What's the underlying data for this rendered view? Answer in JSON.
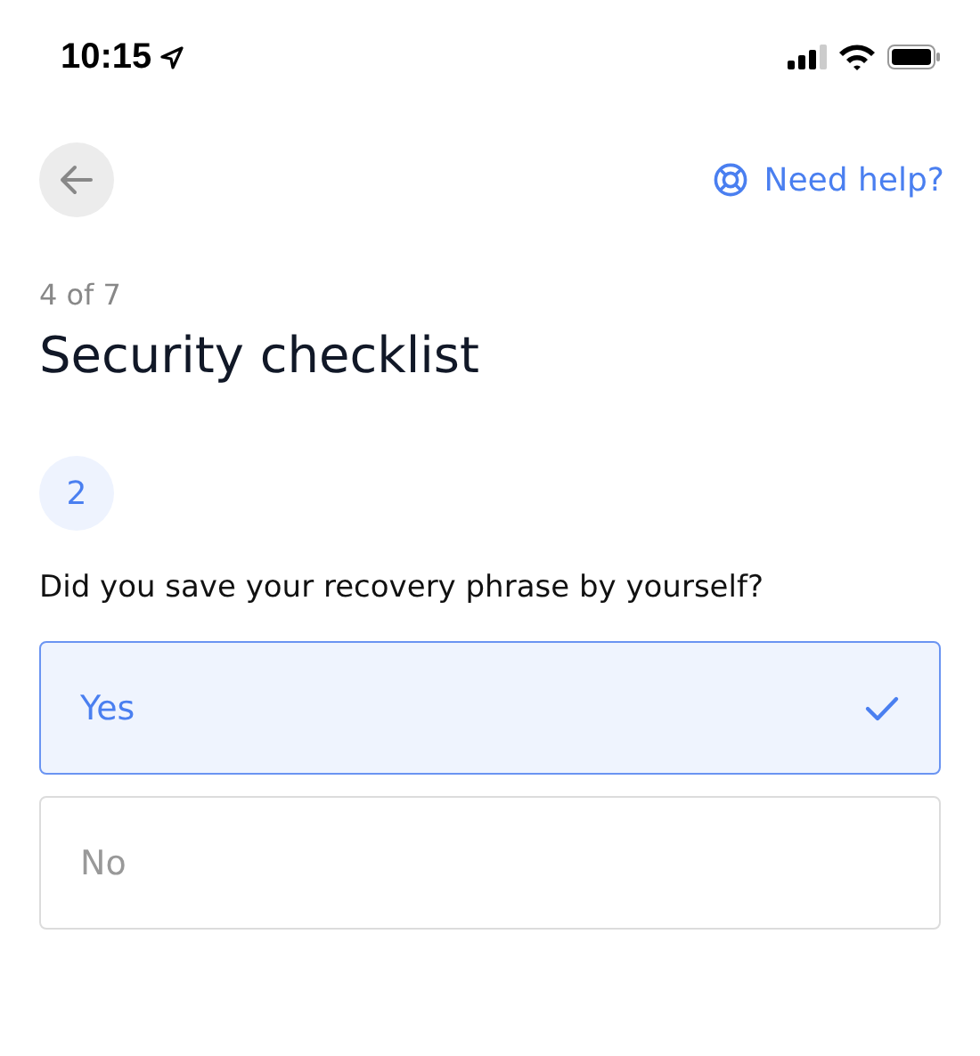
{
  "status_bar": {
    "time": "10:15"
  },
  "help_link": {
    "label": "Need help?"
  },
  "step": "4 of 7",
  "title": "Security checklist",
  "question_number": "2",
  "question": "Did you save your recovery phrase by yourself?",
  "options": [
    {
      "label": "Yes",
      "selected": true
    },
    {
      "label": "No",
      "selected": false
    }
  ]
}
